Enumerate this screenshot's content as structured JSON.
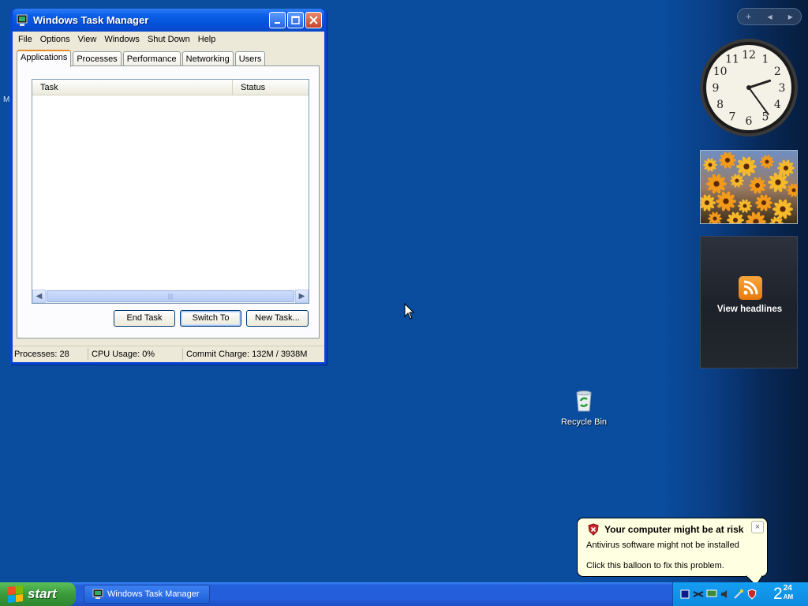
{
  "desktop": {
    "fragment_letter": "M"
  },
  "task_manager": {
    "title": "Windows Task Manager",
    "menu": [
      "File",
      "Options",
      "View",
      "Windows",
      "Shut Down",
      "Help"
    ],
    "tabs": [
      "Applications",
      "Processes",
      "Performance",
      "Networking",
      "Users"
    ],
    "active_tab": "Applications",
    "columns": [
      "Task",
      "Status"
    ],
    "tasks": [],
    "buttons": {
      "end_task": "End Task",
      "switch_to": "Switch To",
      "new_task": "New Task..."
    },
    "status": {
      "processes": "Processes: 28",
      "cpu": "CPU Usage: 0%",
      "commit": "Commit Charge: 132M / 3938M"
    }
  },
  "sidebar": {
    "controls": [
      "+",
      "◂",
      "▸"
    ],
    "clock": {
      "numbers": [
        "12",
        "1",
        "2",
        "3",
        "4",
        "5",
        "6",
        "7",
        "8",
        "9",
        "10",
        "11"
      ],
      "hour": 2,
      "minute": 24
    },
    "headlines_label": "View headlines"
  },
  "recycle_bin": {
    "label": "Recycle Bin"
  },
  "balloon": {
    "title": "Your computer might be at risk",
    "line1": "Antivirus software might not be installed",
    "line2": "Click this balloon to fix this problem.",
    "close": "×"
  },
  "taskbar": {
    "start_label": "start",
    "task_button": "Windows Task Manager",
    "clock_hour": "2",
    "clock_minute": "24",
    "clock_ampm": "AM"
  },
  "colors": {
    "desktop": "#0a4c9e",
    "title_bar": "#0450d8",
    "taskbar": "#245edb",
    "start_green": "#3a9b3a",
    "balloon_bg": "#ffffe1"
  }
}
